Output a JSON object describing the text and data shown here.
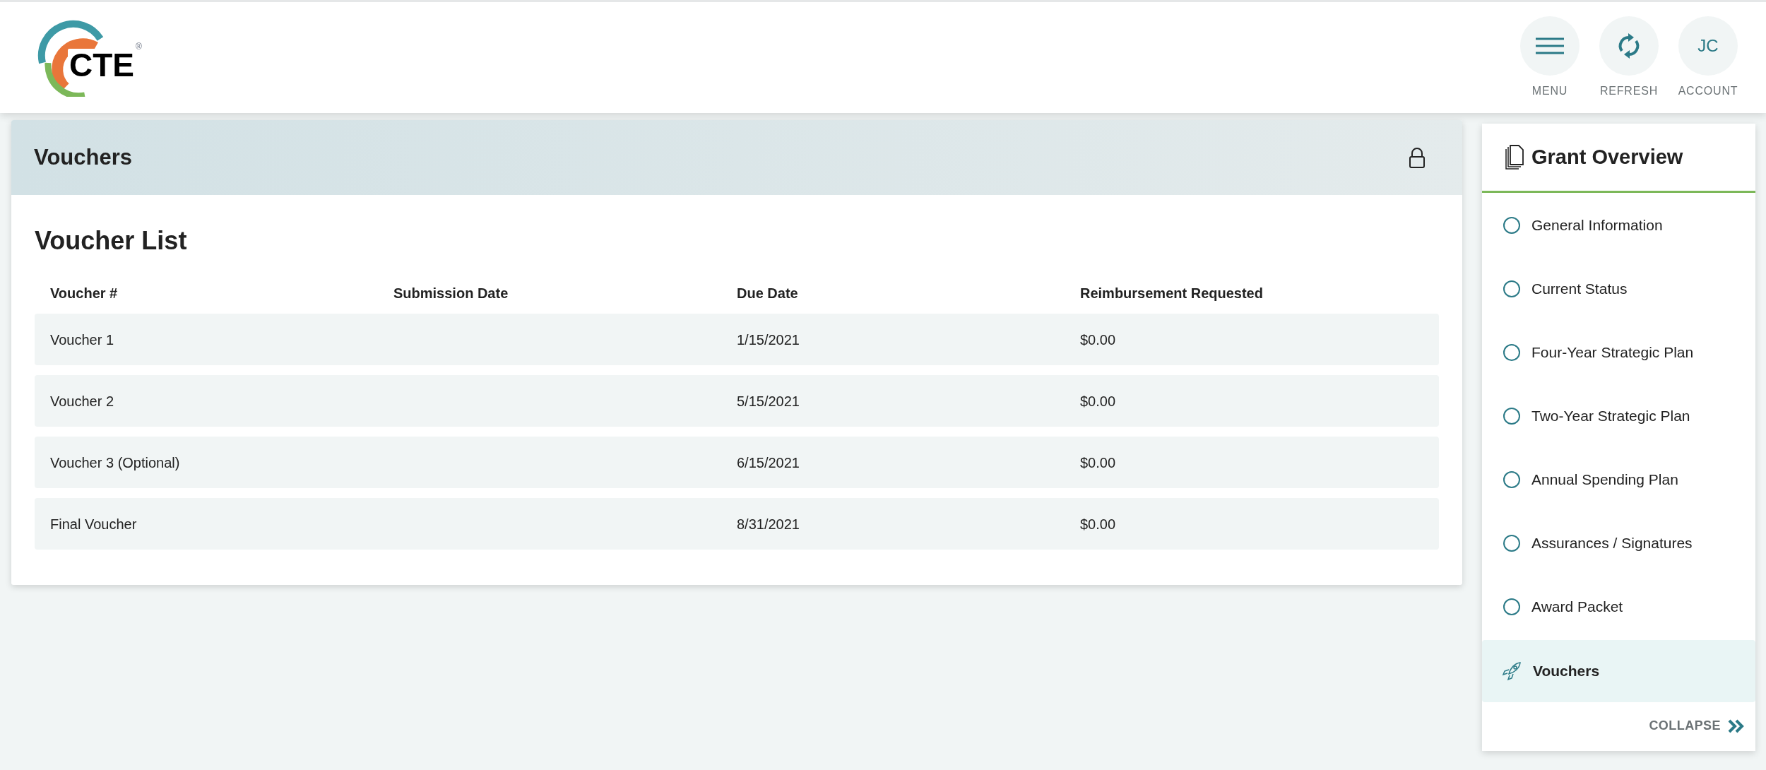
{
  "logo": {
    "text": "CTE",
    "mark": "®"
  },
  "header_actions": [
    {
      "kind": "menu",
      "label": "MENU"
    },
    {
      "kind": "refresh",
      "label": "REFRESH"
    },
    {
      "kind": "initials",
      "initials": "JC",
      "label": "ACCOUNT"
    }
  ],
  "panel": {
    "title": "Vouchers",
    "locked": true,
    "heading": "Voucher List",
    "table": {
      "columns": [
        "Voucher #",
        "Submission Date",
        "Due Date",
        "Reimbursement Requested"
      ],
      "rows": [
        [
          "Voucher 1",
          "",
          "1/15/2021",
          "$0.00"
        ],
        [
          "Voucher 2",
          "",
          "5/15/2021",
          "$0.00"
        ],
        [
          "Voucher 3 (Optional)",
          "",
          "6/15/2021",
          "$0.00"
        ],
        [
          "Final Voucher",
          "",
          "8/31/2021",
          "$0.00"
        ]
      ]
    }
  },
  "sidebar": {
    "title": "Grant Overview",
    "items": [
      {
        "label": "General Information",
        "selected": false
      },
      {
        "label": "Current Status",
        "selected": false
      },
      {
        "label": "Four-Year Strategic Plan",
        "selected": false
      },
      {
        "label": "Two-Year Strategic Plan",
        "selected": false
      },
      {
        "label": "Annual Spending Plan",
        "selected": false
      },
      {
        "label": "Assurances / Signatures",
        "selected": false
      },
      {
        "label": "Award Packet",
        "selected": false
      },
      {
        "label": "Vouchers",
        "selected": true
      }
    ],
    "collapse": "COLLAPSE"
  }
}
